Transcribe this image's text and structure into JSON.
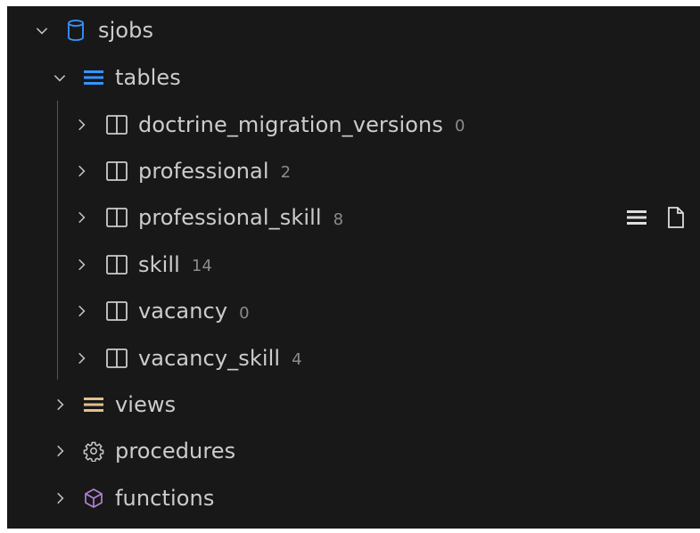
{
  "tree": {
    "database": {
      "label": "sjobs",
      "icon": "database-icon",
      "expanded": true
    },
    "tables_group": {
      "label": "tables",
      "icon": "list-icon",
      "icon_color": "#3794ff",
      "expanded": true
    },
    "tables": [
      {
        "label": "doctrine_migration_versions",
        "count": "0"
      },
      {
        "label": "professional",
        "count": "2"
      },
      {
        "label": "professional_skill",
        "count": "8"
      },
      {
        "label": "skill",
        "count": "14"
      },
      {
        "label": "vacancy",
        "count": "0"
      },
      {
        "label": "vacancy_skill",
        "count": "4"
      }
    ],
    "views_group": {
      "label": "views",
      "icon": "list-icon",
      "icon_color": "#e2c08d"
    },
    "procedures_group": {
      "label": "procedures",
      "icon": "gear-icon"
    },
    "functions_group": {
      "label": "functions",
      "icon": "cube-icon",
      "icon_color": "#b180d7"
    }
  },
  "hover_actions": {
    "row": "professional_skill",
    "icons": [
      "list-icon",
      "file-icon"
    ]
  },
  "colors": {
    "background": "#181818",
    "text": "#cccccc",
    "count": "#8b8b8b",
    "database_icon": "#3794ff"
  }
}
